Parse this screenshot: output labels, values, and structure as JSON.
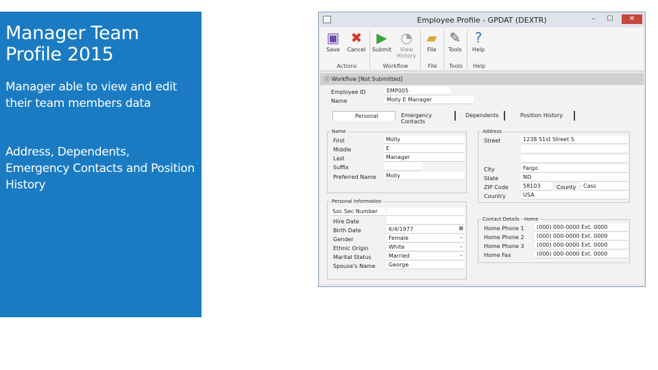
{
  "slide": {
    "title_line1": "Manager Team",
    "title_line2": "Profile 2015",
    "para1_line1": "Manager able to view and edit",
    "para1_line2": "their team members data",
    "para2_line1": "Address, Dependents,",
    "para2_line2": "Emergency Contacts and Position",
    "para2_line3": "History"
  },
  "window": {
    "title": "Employee Profile - GPDAT (DEXTR)",
    "min": "–",
    "max": "☐",
    "close": "✕"
  },
  "ribbon": {
    "save": "Save",
    "cancel": "Cancel",
    "submit": "Submit",
    "view_history": "View History",
    "file": "File",
    "tools": "Tools",
    "help": "Help",
    "group_actions": "Actions",
    "group_workflow": "Workflow",
    "group_file": "File",
    "group_tools": "Tools",
    "group_help": "Help"
  },
  "status": {
    "text": "Workflow [Not Submitted]"
  },
  "employee": {
    "id_label": "Employee ID",
    "id_value": "EMP005",
    "name_label": "Name",
    "name_value": "Molly E Manager"
  },
  "tabs": [
    "Personal",
    "Emergency Contacts",
    "Dependents",
    "Position History"
  ],
  "name_group": {
    "title": "Name",
    "first_label": "First",
    "first_value": "Molly",
    "middle_label": "Middle",
    "middle_value": "E",
    "last_label": "Last",
    "last_value": "Manager",
    "suffix_label": "Suffix",
    "suffix_value": "",
    "preferred_label": "Preferred Name",
    "preferred_value": "Molly"
  },
  "address_group": {
    "title": "Address",
    "street_label": "Street",
    "street_value": "1238 51st Street S",
    "city_label": "City",
    "city_value": "Fargo",
    "state_label": "State",
    "state_value": "ND",
    "zip_label": "ZIP Code",
    "zip_value": "58103",
    "county_label": "County",
    "county_value": "Cass",
    "country_label": "Country",
    "country_value": "USA"
  },
  "personal_group": {
    "title": "Personal Information",
    "ssn_label": "Soc Sec Number",
    "ssn_value": "",
    "hire_label": "Hire Date",
    "hire_value": "",
    "birth_label": "Birth Date",
    "birth_value": "6/4/1977",
    "gender_label": "Gender",
    "gender_value": "Female",
    "ethnic_label": "Ethnic Origin",
    "ethnic_value": "White",
    "marital_label": "Marital Status",
    "marital_value": "Married",
    "spouse_label": "Spouse's Name",
    "spouse_value": "George"
  },
  "contact_group": {
    "title": "Contact Details - Home",
    "phone1_label": "Home Phone 1",
    "phone1_value": "(000) 000-0000 Ext. 0000",
    "phone2_label": "Home Phone 2",
    "phone2_value": "(000) 000-0000 Ext. 0000",
    "phone3_label": "Home Phone 3",
    "phone3_value": "(000) 000-0000 Ext. 0000",
    "fax_label": "Home Fax",
    "fax_value": "(000) 000-0000 Ext. 0000"
  }
}
